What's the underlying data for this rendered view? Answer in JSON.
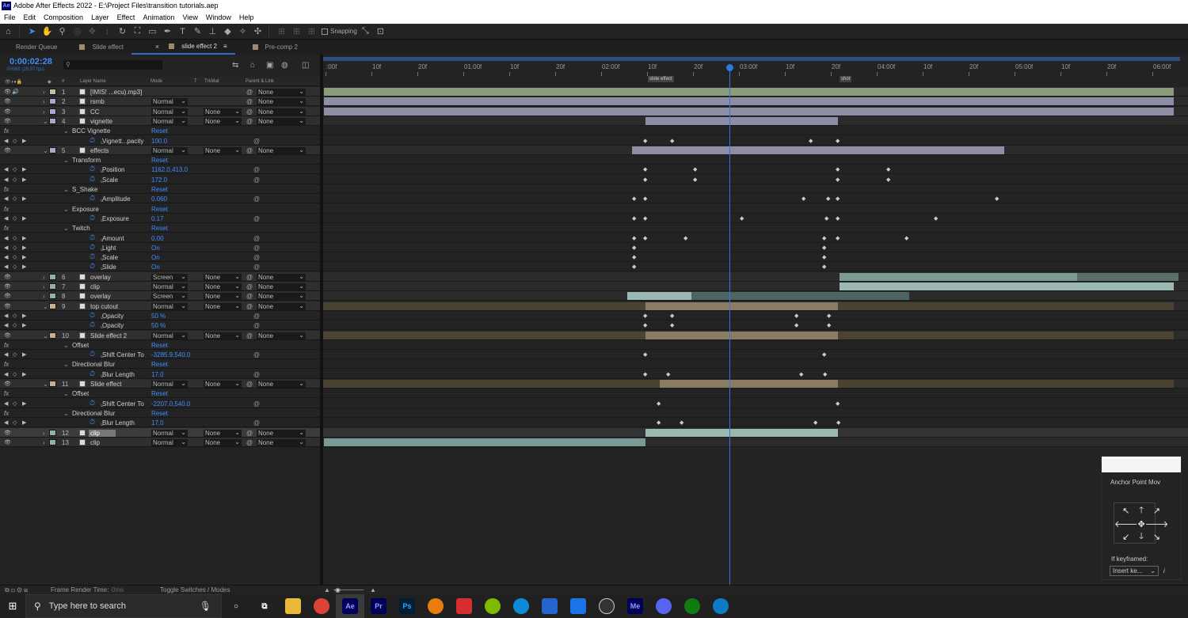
{
  "window": {
    "title": "Adobe After Effects 2022 - E:\\Project Files\\transition tutorials.aep",
    "app_icon": "Ae"
  },
  "menu": [
    "File",
    "Edit",
    "Composition",
    "Layer",
    "Effect",
    "Animation",
    "View",
    "Window",
    "Help"
  ],
  "toolbar": {
    "snapping_label": "Snapping"
  },
  "tabs": [
    {
      "label": "Render Queue",
      "color": ""
    },
    {
      "label": "Slide effect",
      "color": "#9c8c6c"
    },
    {
      "label": "slide effect 2",
      "color": "#9c8c6c",
      "active": true
    },
    {
      "label": "Pre-comp 2",
      "color": "#9c8c6c"
    }
  ],
  "timeline": {
    "timecode": "0:00:02:28",
    "frame_info": "00088 (29.97 fps)",
    "search_placeholder": "",
    "columns": {
      "num": "#",
      "layer_name": "Layer Name",
      "mode": "Mode",
      "t": "T",
      "trkmat": "TrkMat",
      "parent": "Parent & Link"
    },
    "ruler_labels": [
      ":00f",
      "10f",
      "20f",
      "01:00f",
      "10f",
      "20f",
      "02:00f",
      "10f",
      "20f",
      "03:00f",
      "10f",
      "20f",
      "04:00f",
      "10f",
      "20f",
      "05:00f",
      "10f",
      "20f",
      "06:00f"
    ],
    "markers": [
      "slide effect",
      "shot"
    ]
  },
  "rows": [
    {
      "type": "layer",
      "num": "1",
      "name": "[IMIS!  ...ecu).mp3]",
      "label": "#b7c7a2",
      "mode": "",
      "trk": "",
      "parent": "None",
      "audio": true
    },
    {
      "type": "layer",
      "num": "2",
      "name": "rsmb",
      "label": "#a7a7cf",
      "mode": "Normal",
      "trk": "",
      "parent": "None"
    },
    {
      "type": "layer",
      "num": "3",
      "name": "CC",
      "label": "#a7a7cf",
      "mode": "Normal",
      "trk": "None",
      "parent": "None"
    },
    {
      "type": "layer",
      "num": "4",
      "name": "vignette",
      "label": "#a7a7cf",
      "mode": "Normal",
      "trk": "None",
      "parent": "None",
      "open": true
    },
    {
      "type": "effect",
      "name": "BCC Vignette",
      "reset": "Reset"
    },
    {
      "type": "prop",
      "name": "Vignett...pacity",
      "value": "100.0"
    },
    {
      "type": "layer",
      "num": "5",
      "name": "effects",
      "label": "#a7a7cf",
      "mode": "Normal",
      "trk": "None",
      "parent": "None",
      "open": true
    },
    {
      "type": "group",
      "name": "Transform",
      "reset": "Reset"
    },
    {
      "type": "prop",
      "name": "Position",
      "value": "1162.0,413.0"
    },
    {
      "type": "prop",
      "name": "Scale",
      "value": "172.0"
    },
    {
      "type": "effect",
      "name": "S_Shake",
      "reset": "Reset"
    },
    {
      "type": "prop",
      "name": "Amplitude",
      "value": "0.060"
    },
    {
      "type": "effect",
      "name": "Exposure",
      "reset": "Reset"
    },
    {
      "type": "prop",
      "name": "Exposure",
      "value": "0.17"
    },
    {
      "type": "effect",
      "name": "Twitch",
      "reset": "Reset"
    },
    {
      "type": "prop",
      "name": "Amount",
      "value": "0.00"
    },
    {
      "type": "prop",
      "name": "Light",
      "value": "On"
    },
    {
      "type": "prop",
      "name": "Scale",
      "value": "On"
    },
    {
      "type": "prop",
      "name": "Slide",
      "value": "On"
    },
    {
      "type": "layer",
      "num": "6",
      "name": "overlay",
      "label": "#8fb3a8",
      "mode": "Screen",
      "trk": "None",
      "parent": "None"
    },
    {
      "type": "layer",
      "num": "7",
      "name": "clip",
      "label": "#8fb3a8",
      "mode": "Normal",
      "trk": "None",
      "parent": "None"
    },
    {
      "type": "layer",
      "num": "8",
      "name": "overlay",
      "label": "#8fb3a8",
      "mode": "Screen",
      "trk": "None",
      "parent": "None"
    },
    {
      "type": "layer",
      "num": "9",
      "name": "top cutout",
      "label": "#c7b08a",
      "mode": "Normal",
      "trk": "None",
      "parent": "None",
      "open": true
    },
    {
      "type": "prop",
      "name": "Opacity",
      "value": "50 %"
    },
    {
      "type": "prop",
      "name": "Opacity",
      "value": "50 %"
    },
    {
      "type": "layer",
      "num": "10",
      "name": "Slide effect 2",
      "label": "#c7b08a",
      "mode": "Normal",
      "trk": "None",
      "parent": "None",
      "open": true
    },
    {
      "type": "effect",
      "name": "Offset",
      "reset": "Reset"
    },
    {
      "type": "prop",
      "name": "Shift Center To",
      "value": "-3285.9,540.0"
    },
    {
      "type": "effect",
      "name": "Directional Blur",
      "reset": "Reset"
    },
    {
      "type": "prop",
      "name": "Blur Length",
      "value": "17.0"
    },
    {
      "type": "layer",
      "num": "11",
      "name": "Slide effect",
      "label": "#c7b08a",
      "mode": "Normal",
      "trk": "None",
      "parent": "None",
      "open": true
    },
    {
      "type": "effect",
      "name": "Offset",
      "reset": "Reset"
    },
    {
      "type": "prop",
      "name": "Shift Center To",
      "value": "-2207.0,540.0"
    },
    {
      "type": "effect",
      "name": "Directional Blur",
      "reset": "Reset"
    },
    {
      "type": "prop",
      "name": "Blur Length",
      "value": "17.0"
    },
    {
      "type": "layer",
      "num": "12",
      "name": "clip",
      "label": "#8fb3a8",
      "mode": "Normal",
      "trk": "None",
      "parent": "None",
      "selected": true
    },
    {
      "type": "layer",
      "num": "13",
      "name": "clip",
      "label": "#8fb3a8",
      "mode": "Normal",
      "trk": "None",
      "parent": "None"
    }
  ],
  "status": {
    "frame_render_label": "Frame Render Time:",
    "frame_render_value": "0ms",
    "toggle_label": "Toggle Switches / Modes"
  },
  "anchor_panel": {
    "title": "Anchor Point Mov",
    "keyframed_label": "If keyframed:",
    "select_value": "Insert ke...",
    "info": "i"
  },
  "taskbar": {
    "search_placeholder": "Type here to search"
  },
  "colors": {
    "accent": "#2b7ae0",
    "value_blue": "#3f8cff",
    "audio_bar": "#8b9c7d",
    "solid_bar": "#8d8da5",
    "footage_bar": "#9bb8b2",
    "comp_bar": "#6e6350"
  }
}
